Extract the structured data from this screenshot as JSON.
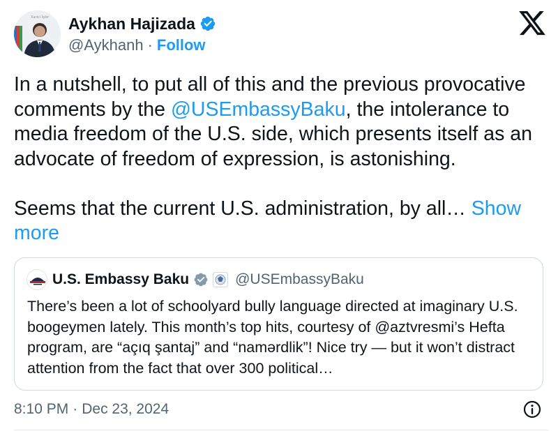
{
  "author": {
    "name": "Aykhan Hajizada",
    "handle": "@Aykhanh",
    "follow_label": "Follow",
    "verified": true,
    "avatar_caption": "Xarici İşlər"
  },
  "icons": {
    "x_logo": "x-logo-icon",
    "verified": "verified-badge-icon",
    "info": "info-icon"
  },
  "tweet": {
    "line1_prefix": "In a nutshell, to put all of this and the previous provocative comments by the ",
    "mention": "@USEmbassyBaku",
    "line1_suffix": ", the intolerance to media freedom of the U.S. side, which presents itself as an advocate of freedom of expression, is astonishing.",
    "line2": "Seems that the current U.S. administration, by all… ",
    "show_more": "Show more"
  },
  "quote": {
    "name": "U.S. Embassy Baku",
    "handle": "@USEmbassyBaku",
    "text": "There’s been a lot of schoolyard bully language directed at imaginary U.S. boogeymen lately.  This month’s top hits, courtesy of @aztvresmi’s  Hefta program, are “açıq şantaj” and “namərdlik”! Nice try — but it won’t distract attention from the fact that over 300 political…"
  },
  "footer": {
    "time": "8:10 PM",
    "separator": "·",
    "date": "Dec 23, 2024"
  },
  "colors": {
    "link": "#1d9bf0",
    "text": "#0f1419",
    "secondary": "#536471",
    "border": "#cfd9de"
  }
}
